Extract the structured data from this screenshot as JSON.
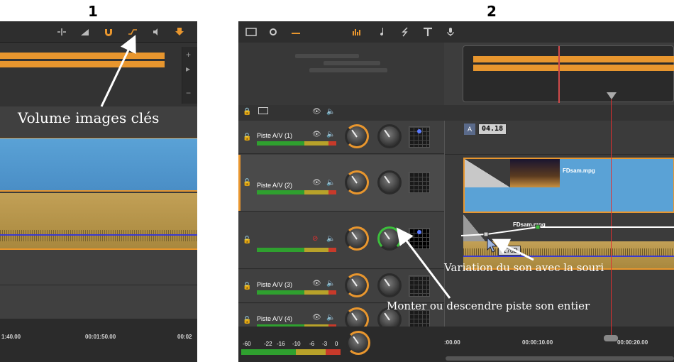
{
  "labels": {
    "panel1": "1",
    "panel2": "2"
  },
  "panel1": {
    "callout": "Volume images clés",
    "ruler": [
      "1:40.00",
      "00:01:50.00",
      "00:02"
    ],
    "scroll_plus": "+",
    "scroll_minus": "−",
    "scroll_arrow": "▸"
  },
  "panel2": {
    "tracks": [
      {
        "name": "Piste A/V (1)"
      },
      {
        "name": "Piste A/V (2)"
      },
      {
        "name": ""
      },
      {
        "name": "Piste A/V (3)"
      },
      {
        "name": "Piste A/V (4)"
      }
    ],
    "clip_video": "FDsam.mpg",
    "clip_audio": "FDsam.mpg",
    "timecode_prefix": "A",
    "timecode": "04.18",
    "db_value": "-17dB",
    "callout_variation": "Variation du son avec la souri",
    "callout_monter": "Monter ou descendre piste son entier",
    "meter_scale": [
      "-60",
      "-22",
      "-16",
      "-10",
      "-6",
      "-3",
      "0"
    ],
    "ruler": [
      ":00.00",
      "00:00:10.00",
      "00:00:20.00"
    ]
  },
  "colors": {
    "accent": "#e8962e",
    "video_clip": "#5aa2d6",
    "audio_clip": "#b8954a",
    "playhead": "#e03030"
  },
  "icons": [
    "split-icon",
    "fx-icon",
    "magnet-icon",
    "volume-keyframes-icon",
    "speaker-icon",
    "import-icon",
    "track-menu-icon",
    "settings-icon",
    "audio-mixer-icon",
    "music-icon",
    "title-icon",
    "mic-icon",
    "lock-icon",
    "eye-icon",
    "speaker-small-icon"
  ]
}
